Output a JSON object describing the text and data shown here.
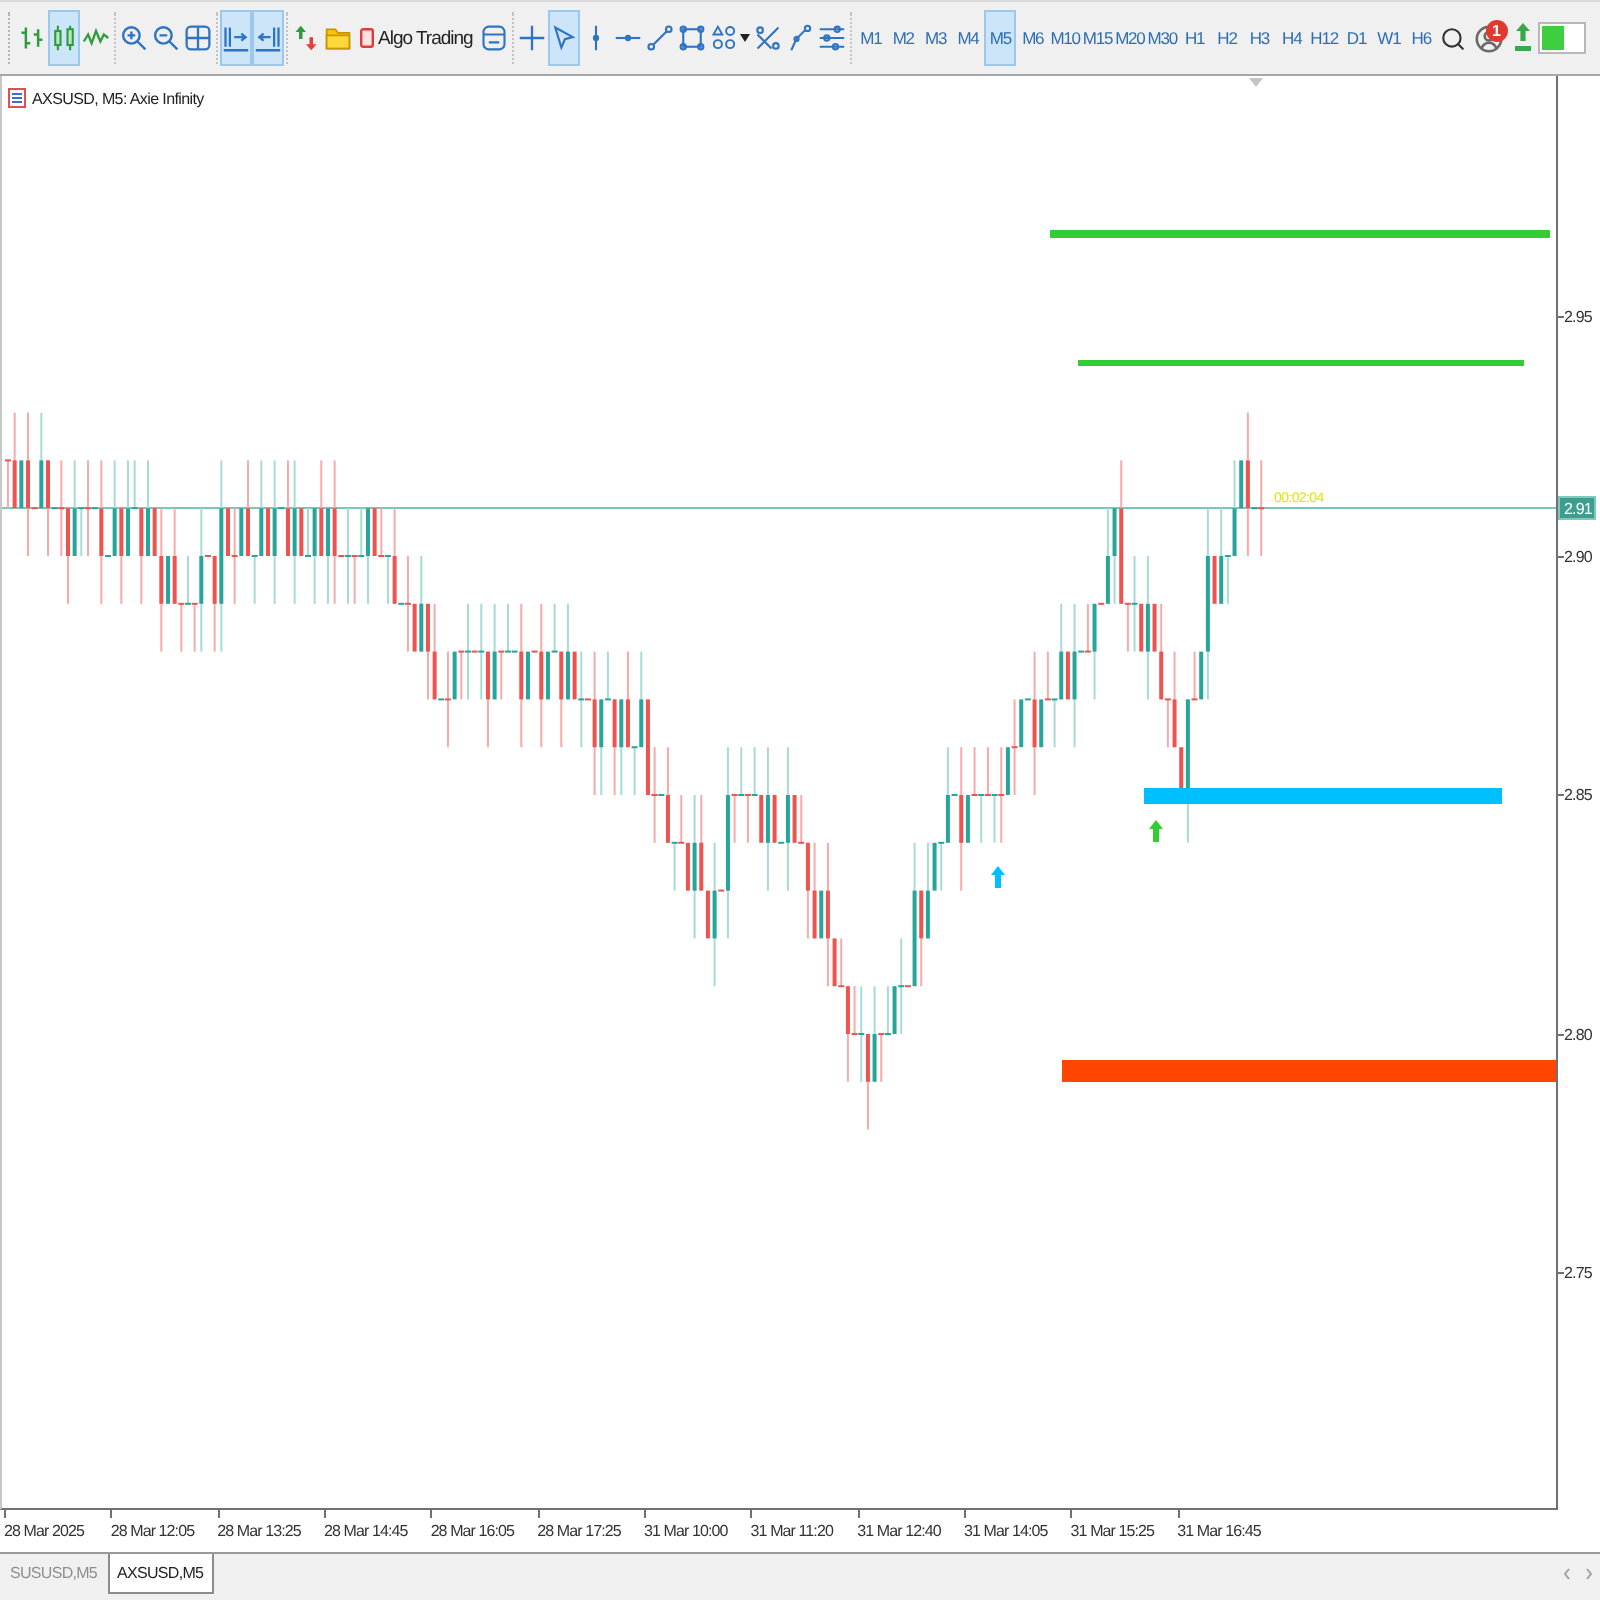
{
  "toolbar": {
    "groups": [
      {
        "buttons": [
          {
            "kind": "bars",
            "selected": false
          },
          {
            "kind": "candles",
            "selected": true
          },
          {
            "kind": "line",
            "selected": false
          }
        ]
      },
      {
        "buttons": [
          {
            "kind": "zoomin"
          },
          {
            "kind": "zoomout"
          },
          {
            "kind": "tile"
          }
        ]
      },
      {
        "buttons": [
          {
            "kind": "shift",
            "selected": true
          },
          {
            "kind": "autoscroll",
            "selected": true
          }
        ]
      },
      {
        "buttons": [
          {
            "kind": "indicators"
          },
          {
            "kind": "navigator"
          },
          {
            "kind": "algotrading",
            "label": "Algo Trading",
            "on": false
          },
          {
            "kind": "datawindow"
          }
        ]
      },
      {
        "buttons": [
          {
            "kind": "crosshair",
            "selected": false
          },
          {
            "kind": "cursor",
            "selected": true
          },
          {
            "kind": "vline",
            "selected": false
          },
          {
            "kind": "hline",
            "selected": false
          },
          {
            "kind": "trendline",
            "selected": false
          },
          {
            "kind": "rectangle",
            "selected": false
          },
          {
            "kind": "shapes",
            "selected": false
          },
          {
            "kind": "fibonacci",
            "selected": false
          },
          {
            "kind": "pen",
            "selected": false
          },
          {
            "kind": "objects"
          }
        ]
      }
    ],
    "timeframes": [
      {
        "label": "M1",
        "selected": false
      },
      {
        "label": "M2",
        "selected": false
      },
      {
        "label": "M3",
        "selected": false
      },
      {
        "label": "M4",
        "selected": false
      },
      {
        "label": "M5",
        "selected": true
      },
      {
        "label": "M6",
        "selected": false
      },
      {
        "label": "M10",
        "selected": false
      },
      {
        "label": "M15",
        "selected": false
      },
      {
        "label": "M20",
        "selected": false
      },
      {
        "label": "M30",
        "selected": false
      },
      {
        "label": "H1",
        "selected": false
      },
      {
        "label": "H2",
        "selected": false
      },
      {
        "label": "H3",
        "selected": false
      },
      {
        "label": "H4",
        "selected": false
      },
      {
        "label": "H12",
        "selected": false
      },
      {
        "label": "D1",
        "selected": false
      },
      {
        "label": "W1",
        "selected": false
      },
      {
        "label": "H6",
        "selected": false
      }
    ],
    "notifications": {
      "count": "1"
    }
  },
  "chart": {
    "title": "AXSUSD, M5: Axie Infinity",
    "levels": [
      {
        "color": "#33cc33"
      },
      {
        "color": "#33cc33"
      },
      {
        "color": "#00bfff"
      },
      {
        "color": "#ff4500"
      }
    ],
    "signals": [
      {
        "color": "#00bfff"
      },
      {
        "color": "#33cc33"
      }
    ],
    "price_ticks": [
      "2.95",
      "2.90",
      "2.85",
      "2.80",
      "2.75"
    ],
    "current_price": "2.91",
    "countdown": "00:02:04",
    "time_labels": [
      "28 Mar 2025",
      "28 Mar 12:05",
      "28 Mar 13:25",
      "28 Mar 14:45",
      "28 Mar 16:05",
      "28 Mar 17:25",
      "31 Mar 10:00",
      "31 Mar 11:20",
      "31 Mar 12:40",
      "31 Mar 14:05",
      "31 Mar 15:25",
      "31 Mar 16:45"
    ]
  },
  "tabs": [
    {
      "label": "SUSUSD,M5",
      "selected": false
    },
    {
      "label": "AXSUSD,M5",
      "selected": true
    }
  ]
}
